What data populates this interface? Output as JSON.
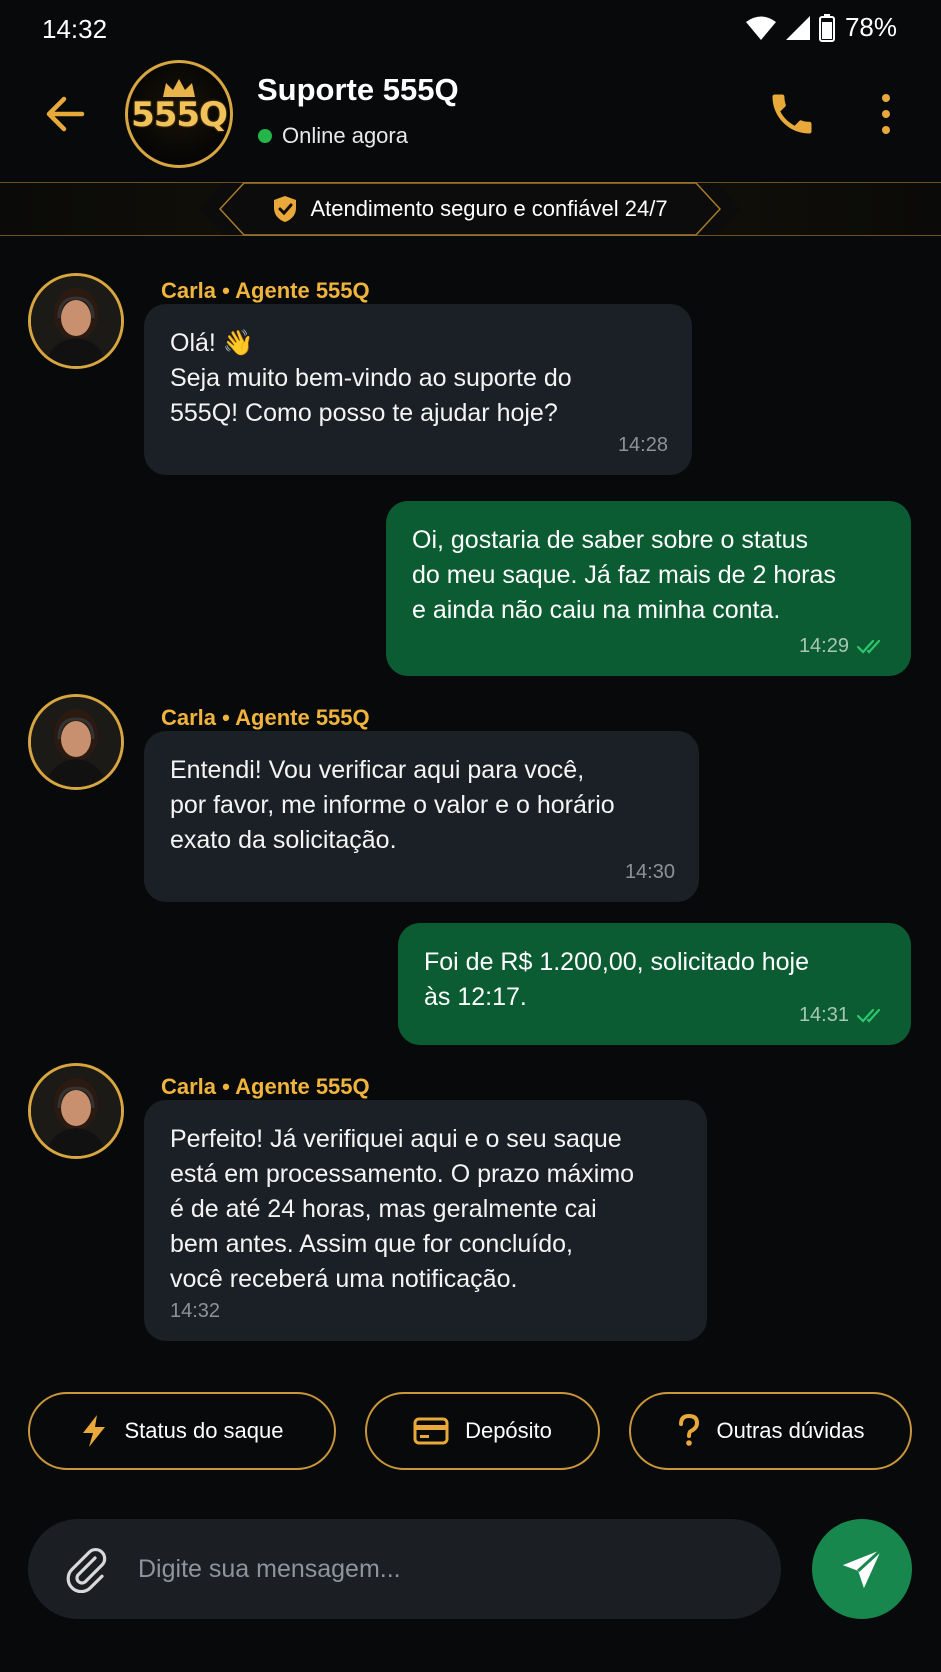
{
  "status_bar": {
    "time": "14:32",
    "battery": "78%"
  },
  "header": {
    "logo_text": "555Q",
    "contact_name": "Suporte 555Q",
    "contact_status": "Online agora"
  },
  "banner": {
    "text": "Atendimento seguro e confiável 24/7"
  },
  "messages": [
    {
      "direction": "in",
      "sender": "Carla • Agente 555Q",
      "text": "Olá! 👋\nSeja muito bem-vindo ao suporte do\n555Q! Como posso te ajudar hoje?",
      "time": "14:28"
    },
    {
      "direction": "out",
      "text": "Oi, gostaria de saber sobre o status\ndo meu saque. Já faz mais de 2 horas\ne ainda não caiu na minha conta.",
      "time": "14:29",
      "read": true
    },
    {
      "direction": "in",
      "sender": "Carla • Agente 555Q",
      "text": "Entendi! Vou verificar aqui para você,\npor favor, me informe o valor e o horário\nexato da solicitação.",
      "time": "14:30"
    },
    {
      "direction": "out",
      "text": "Foi de R$ 1.200,00, solicitado hoje\nàs 12:17.",
      "time": "14:31",
      "read": true
    },
    {
      "direction": "in",
      "sender": "Carla • Agente 555Q",
      "text": "Perfeito! Já verifiquei aqui e o seu saque\nestá em processamento. O prazo máximo\né de até 24 horas, mas geralmente cai\nbem antes. Assim que for concluído,\nvocê receberá uma notificação.",
      "time": "14:32"
    }
  ],
  "quick_replies": [
    {
      "label": "Status do saque",
      "icon": "lightning-icon"
    },
    {
      "label": "Depósito",
      "icon": "card-icon"
    },
    {
      "label": "Outras dúvidas",
      "icon": "question-icon"
    }
  ],
  "composer": {
    "placeholder": "Digite sua mensagem..."
  },
  "colors": {
    "accent_gold": "#f0b43c",
    "outgoing_bubble": "#0b5c33",
    "incoming_bubble": "#1b2026",
    "send_button": "#17874e",
    "online": "#23b64b"
  }
}
